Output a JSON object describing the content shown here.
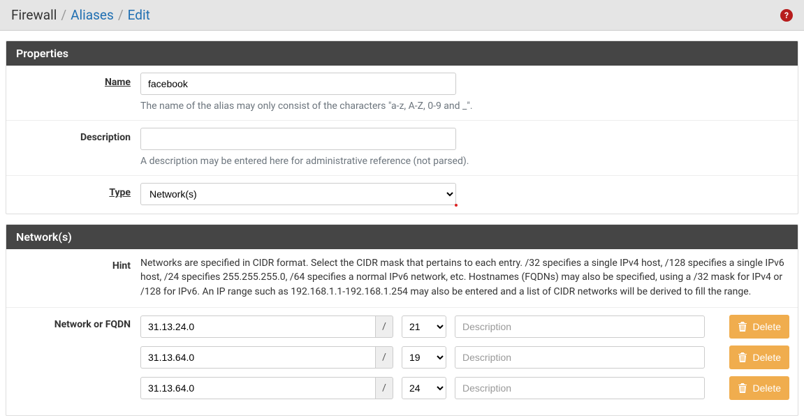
{
  "breadcrumb": {
    "seg1": "Firewall",
    "seg2": "Aliases",
    "seg3": "Edit"
  },
  "panels": {
    "properties_title": "Properties",
    "networks_title": "Network(s)"
  },
  "labels": {
    "name": "Name",
    "description": "Description",
    "type": "Type",
    "hint": "Hint",
    "network_or_fqdn": "Network or FQDN"
  },
  "fields": {
    "name_value": "facebook",
    "name_help": "The name of the alias may only consist of the characters \"a-z, A-Z, 0-9 and _\".",
    "description_value": "",
    "description_help": "A description may be entered here for administrative reference (not parsed).",
    "type_value": "Network(s)"
  },
  "hint_text": "Networks are specified in CIDR format. Select the CIDR mask that pertains to each entry. /32 specifies a single IPv4 host, /128 specifies a single IPv6 host, /24 specifies 255.255.255.0, /64 specifies a normal IPv6 network, etc. Hostnames (FQDNs) may also be specified, using a /32 mask for IPv4 or /128 for IPv6. An IP range such as 192.168.1.1-192.168.1.254 may also be entered and a list of CIDR networks will be derived to fill the range.",
  "entries": [
    {
      "address": "31.13.24.0",
      "cidr": "21",
      "desc": ""
    },
    {
      "address": "31.13.64.0",
      "cidr": "19",
      "desc": ""
    },
    {
      "address": "31.13.64.0",
      "cidr": "24",
      "desc": ""
    }
  ],
  "placeholders": {
    "entry_desc": "Description"
  },
  "buttons": {
    "delete": "Delete"
  },
  "slash": "/"
}
